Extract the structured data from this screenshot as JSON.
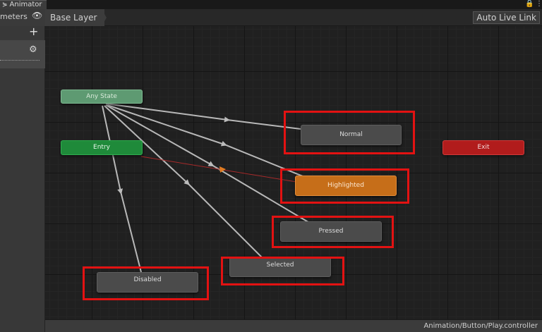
{
  "window": {
    "tab_title": "Animator",
    "tab_icon": "animator-icon",
    "lock_glyph": "🔒",
    "menu_glyph": "⋮"
  },
  "left_panel": {
    "title": "meters",
    "eye_icon": "eye-icon",
    "add_glyph": "+",
    "gear_glyph": "⚙"
  },
  "toolbar": {
    "breadcrumb": "Base Layer",
    "auto_live_link": "Auto Live Link"
  },
  "states": {
    "any_state": "Any State",
    "entry": "Entry",
    "exit": "Exit",
    "normal": "Normal",
    "highlighted": "Highlighted",
    "pressed": "Pressed",
    "selected": "Selected",
    "disabled": "Disabled"
  },
  "status": {
    "path": "Animation/Button/Play.controller"
  },
  "colors": {
    "highlight_box": "#e31212",
    "entry": "#1f8a3a",
    "exit": "#b11c1c",
    "default_state": "#c66e19",
    "any_state": "#5e9a72"
  }
}
